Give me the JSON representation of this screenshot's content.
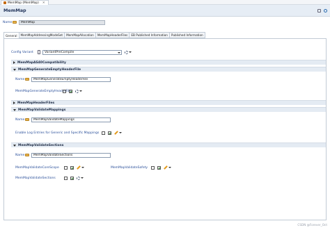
{
  "window_tab": {
    "label": "MemMap (MemMap)",
    "close": "✕"
  },
  "header": {
    "title": "MemMap"
  },
  "name_field": {
    "label": "Name",
    "value": "MemMap"
  },
  "subtabs": [
    "General",
    "MemMapAddressingModeSet",
    "MemMapAllocation",
    "MemMapHeaderFiles",
    "EB Published Information",
    "Published Information"
  ],
  "config_variant": {
    "label": "Config Variant",
    "value": "VariantPreCompile"
  },
  "sections": {
    "as40": "MemMapAS40Compatibility",
    "gen_empty": "MemMapGenerateEmptyHeaderFile",
    "header_files": "MemMapHeaderFiles",
    "validate_mappings": "MemMapValidateMappings",
    "validate_sections": "MemMapValidateSections"
  },
  "gen_empty": {
    "name_label": "Name",
    "name_value": "MemMapGenerateEmptyHeaderFile",
    "param_label": "MemMapGenerateEmptyHeaderFile"
  },
  "validate_mappings": {
    "name_label": "Name",
    "name_value": "MemMapValidateMappings",
    "param_label": "Enable Log Entries for Generic and Specific Mappings"
  },
  "validate_sections": {
    "name_label": "Name",
    "name_value": "MemMapValidateSections",
    "param_core_scope": "MemMapValidateCoreScope",
    "param_safety": "MemMapValidateSafety",
    "param_sections": "MemMapValidateSections"
  },
  "watermark": "CSDN @Forever_Oct",
  "colors": {
    "label_blue": "#2a4f9a",
    "section_bg": "#e4ebf3",
    "header_bg": "#e6edf5"
  }
}
